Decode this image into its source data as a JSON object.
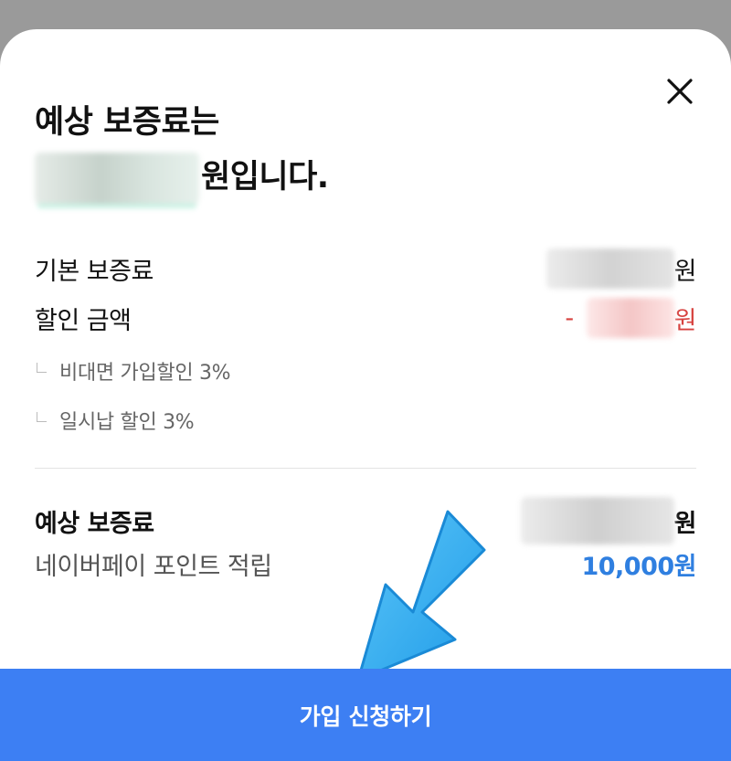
{
  "modal": {
    "title_line1": "예상 보증료는",
    "title_line2_suffix": "원입니다.",
    "close_icon": "close-icon"
  },
  "breakdown": {
    "base_label": "기본 보증료",
    "base_unit": "원",
    "discount_label": "할인 금액",
    "discount_sign": "-",
    "discount_unit": "원",
    "discount_items": [
      {
        "label": "비대면 가입할인 3%"
      },
      {
        "label": "일시납 할인 3%"
      }
    ]
  },
  "summary": {
    "total_label": "예상 보증료",
    "total_unit": "원",
    "points_label": "네이버페이 포인트 적립",
    "points_value": "10,000원"
  },
  "cta": {
    "label": "가입 신청하기"
  },
  "colors": {
    "accent": "#3d7ff3",
    "discount": "#d7423f",
    "points": "#2f7fe0",
    "overlay_arrow": "#2fa9f0"
  }
}
